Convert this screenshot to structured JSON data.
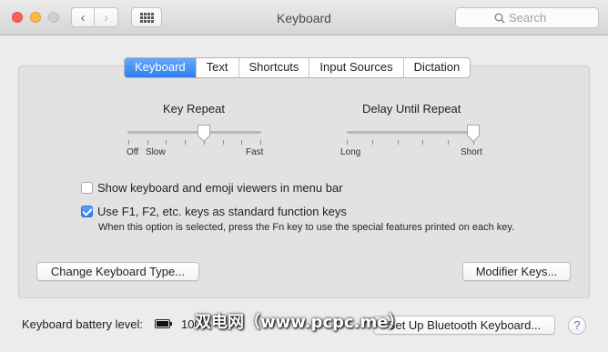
{
  "window": {
    "title": "Keyboard"
  },
  "search": {
    "placeholder": "Search"
  },
  "tabs": [
    "Keyboard",
    "Text",
    "Shortcuts",
    "Input Sources",
    "Dictation"
  ],
  "active_tab": "Keyboard",
  "key_repeat": {
    "title": "Key Repeat",
    "labels": {
      "off": "Off",
      "slow": "Slow",
      "fast": "Fast"
    },
    "ticks": 8,
    "value_fraction": 0.57
  },
  "delay_until_repeat": {
    "title": "Delay Until Repeat",
    "labels": {
      "long": "Long",
      "short": "Short"
    },
    "ticks": 6,
    "value_fraction": 1.0
  },
  "options": {
    "show_viewers": {
      "label": "Show keyboard and emoji viewers in menu bar",
      "checked": false
    },
    "fn_keys": {
      "label": "Use F1, F2, etc. keys as standard function keys",
      "checked": true,
      "note": "When this option is selected, press the Fn key to use the special features printed on each key."
    }
  },
  "buttons": {
    "change_type": "Change Keyboard Type...",
    "modifier_keys": "Modifier Keys...",
    "bluetooth": "Set Up Bluetooth Keyboard...",
    "help": "?"
  },
  "battery": {
    "label": "Keyboard battery level:",
    "value": "100%"
  },
  "watermark": "双电网（www.pcpc.me）",
  "colors": {
    "accent": "#2e7ff3",
    "panel": "#e2e2e2",
    "window": "#ececec"
  }
}
